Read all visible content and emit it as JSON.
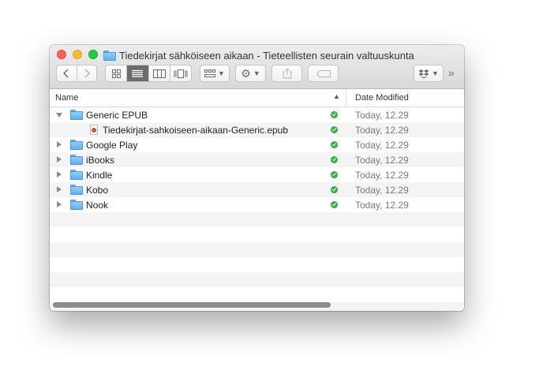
{
  "window": {
    "title": "Tiedekirjat sähköiseen aikaan - Tieteellisten seurain valtuuskunta"
  },
  "toolbar": {
    "back_icon": "chevron-left-icon",
    "forward_icon": "chevron-right-icon",
    "views": [
      "icon-view-icon",
      "list-view-icon",
      "column-view-icon",
      "coverflow-view-icon"
    ],
    "active_view": "list",
    "more": "»"
  },
  "columns": {
    "name": "Name",
    "date_modified": "Date Modified"
  },
  "rows": [
    {
      "name": "Generic EPUB",
      "type": "folder",
      "expanded": true,
      "date": "Today, 12.29"
    },
    {
      "name": "Tiedekirjat-sahkoiseen-aikaan-Generic.epub",
      "type": "file",
      "date": "Today, 12.29"
    },
    {
      "name": "Google Play",
      "type": "folder",
      "expanded": false,
      "date": "Today, 12.29"
    },
    {
      "name": "iBooks",
      "type": "folder",
      "expanded": false,
      "date": "Today, 12.29"
    },
    {
      "name": "Kindle",
      "type": "folder",
      "expanded": false,
      "date": "Today, 12.29"
    },
    {
      "name": "Kobo",
      "type": "folder",
      "expanded": false,
      "date": "Today, 12.29"
    },
    {
      "name": "Nook",
      "type": "folder",
      "expanded": false,
      "date": "Today, 12.29"
    }
  ],
  "colors": {
    "folder": "#5fb1f0",
    "sync_ok": "#2fb344",
    "close": "#fc5f57",
    "minimize": "#fdbc2e",
    "maximize": "#28c840"
  }
}
